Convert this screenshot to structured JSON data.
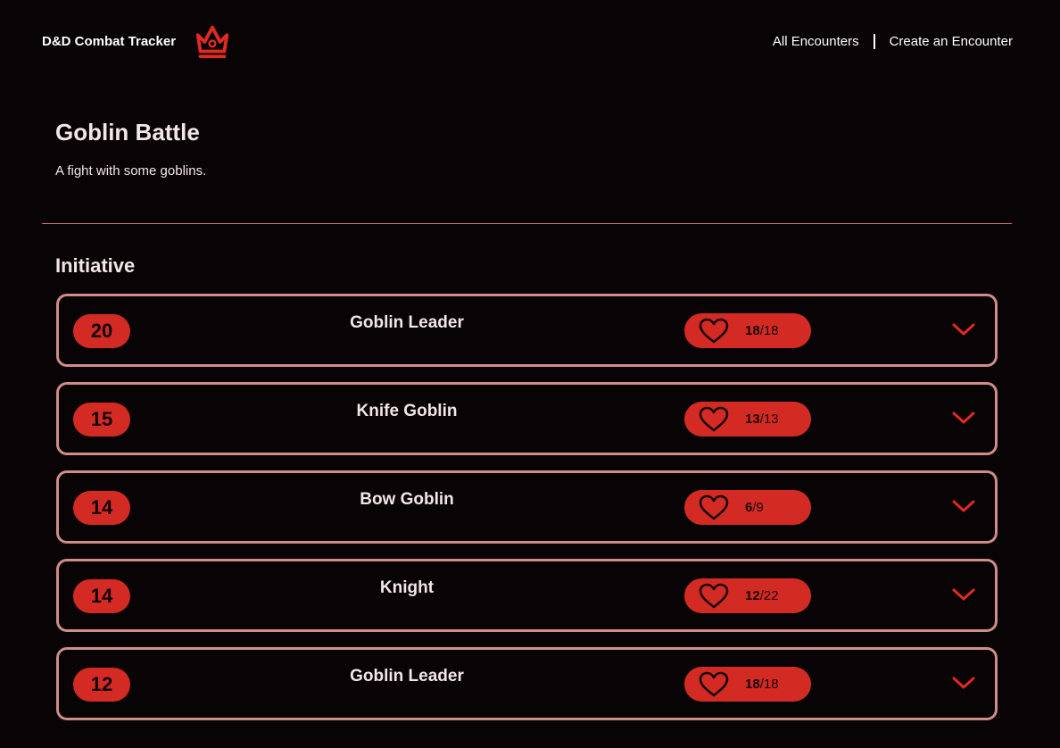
{
  "app": {
    "name": "D&D Combat Tracker",
    "logo_icon": "crown-icon",
    "accent_color": "#d42a24",
    "border_color": "#d08b8b"
  },
  "nav": {
    "links": [
      "All Encounters",
      "Create an Encounter"
    ]
  },
  "encounter": {
    "title": "Goblin Battle",
    "description": "A fight with some goblins."
  },
  "initiative": {
    "heading": "Initiative",
    "rows": [
      {
        "initiative": "20",
        "name": "Goblin Leader",
        "hp_current": "18",
        "hp_separator": "/",
        "hp_max": "18"
      },
      {
        "initiative": "15",
        "name": "Knife Goblin",
        "hp_current": "13",
        "hp_separator": "/",
        "hp_max": "13"
      },
      {
        "initiative": "14",
        "name": "Bow Goblin",
        "hp_current": "6",
        "hp_separator": "/",
        "hp_max": "9"
      },
      {
        "initiative": "14",
        "name": "Knight",
        "hp_current": "12",
        "hp_separator": "/",
        "hp_max": "22"
      },
      {
        "initiative": "12",
        "name": "Goblin Leader",
        "hp_current": "18",
        "hp_separator": "/",
        "hp_max": "18"
      }
    ],
    "row_icons": {
      "health": "heart-icon",
      "expand": "chevron-down-icon"
    }
  }
}
